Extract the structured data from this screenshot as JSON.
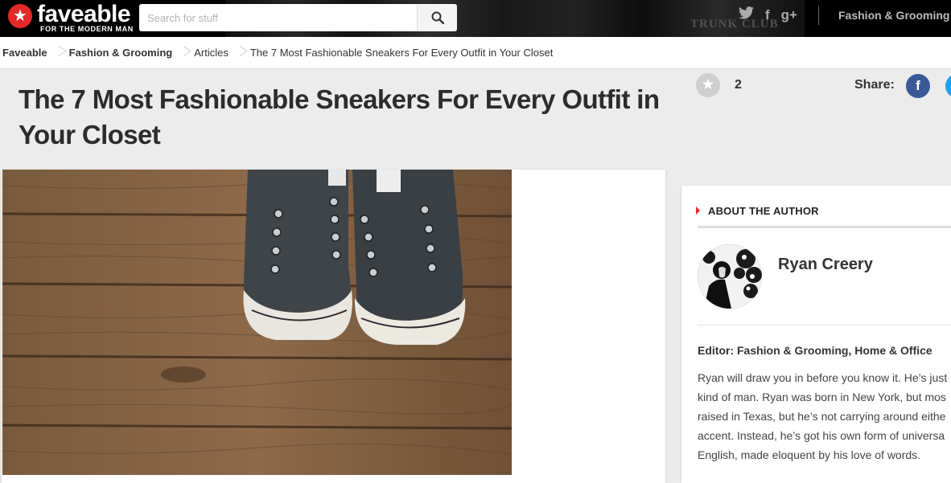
{
  "header": {
    "brand": "faveable",
    "tagline": "FOR THE MODERN MAN",
    "search_placeholder": "Search for stuff",
    "category": "Fashion & Grooming",
    "social": [
      "twitter-icon",
      "facebook-icon",
      "google-plus-icon"
    ],
    "banner_text": "TRUNK CLUB"
  },
  "breadcrumb": [
    {
      "label": "Faveable",
      "bold": true
    },
    {
      "label": "Fashion & Grooming",
      "bold": true
    },
    {
      "label": "Articles",
      "bold": false
    },
    {
      "label": "The 7 Most Fashionable Sneakers For Every Outfit in Your Closet",
      "bold": false
    }
  ],
  "article": {
    "title": "The 7 Most Fashionable Sneakers For Every Outfit in Your Closet",
    "fave_count": "2",
    "share_label": "Share:"
  },
  "sidebar": {
    "heading": "ABOUT THE AUTHOR",
    "author_name": "Ryan Creery",
    "editor_line": "Editor: Fashion & Grooming, Home & Office",
    "bio_lines": [
      "Ryan will draw you in before you know it. He’s just",
      "kind of man. Ryan was born in New York, but mos",
      "raised in Texas, but he’s not carrying around eithe",
      "accent. Instead, he’s got his own form of universa",
      "English, made eloquent by his love of words."
    ]
  },
  "colors": {
    "accent": "#e42827",
    "facebook": "#3b5998",
    "twitter": "#1da1f2"
  }
}
